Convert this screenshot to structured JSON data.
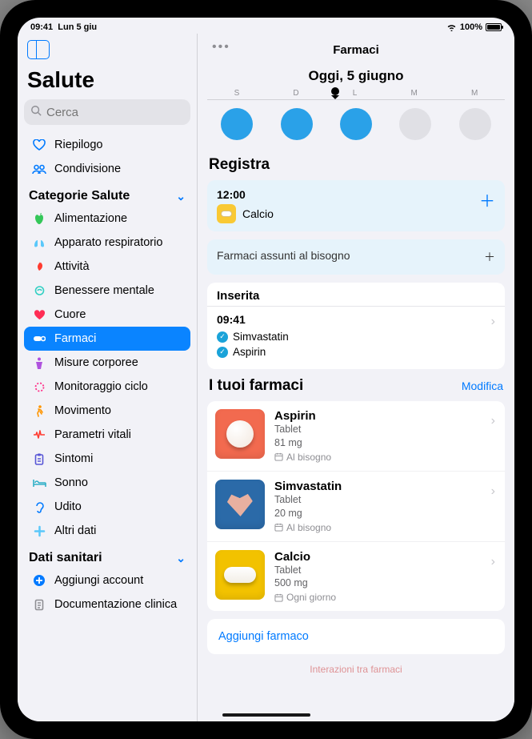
{
  "status": {
    "time": "09:41",
    "date": "Lun 5 giu",
    "battery": "100%"
  },
  "sidebar": {
    "toggle_name": "sidebar-toggle",
    "app_title": "Salute",
    "search_placeholder": "Cerca",
    "top_items": [
      {
        "label": "Riepilogo",
        "icon": "heart-outline",
        "color": "#007aff"
      },
      {
        "label": "Condivisione",
        "icon": "people",
        "color": "#007aff"
      }
    ],
    "categories_title": "Categorie Salute",
    "categories": [
      {
        "label": "Alimentazione",
        "icon": "apple",
        "color": "#34c759"
      },
      {
        "label": "Apparato respiratorio",
        "icon": "lungs",
        "color": "#5ac8fa"
      },
      {
        "label": "Attività",
        "icon": "flame",
        "color": "#ff3b30"
      },
      {
        "label": "Benessere mentale",
        "icon": "mind",
        "color": "#32d0c3"
      },
      {
        "label": "Cuore",
        "icon": "heart",
        "color": "#ff2d55"
      },
      {
        "label": "Farmaci",
        "icon": "pills",
        "color": "#5ac8fa",
        "active": true
      },
      {
        "label": "Misure corporee",
        "icon": "body",
        "color": "#af52de"
      },
      {
        "label": "Monitoraggio ciclo",
        "icon": "cycle",
        "color": "#ff2d87"
      },
      {
        "label": "Movimento",
        "icon": "walk",
        "color": "#ff9500"
      },
      {
        "label": "Parametri vitali",
        "icon": "vitals",
        "color": "#ff3b30"
      },
      {
        "label": "Sintomi",
        "icon": "clipboard",
        "color": "#5856d6"
      },
      {
        "label": "Sonno",
        "icon": "bed",
        "color": "#30b0c7"
      },
      {
        "label": "Udito",
        "icon": "ear",
        "color": "#007aff"
      },
      {
        "label": "Altri dati",
        "icon": "plus",
        "color": "#5ac8fa"
      }
    ],
    "records_title": "Dati sanitari",
    "records": [
      {
        "label": "Aggiungi account",
        "icon": "add-account",
        "color": "#007aff"
      },
      {
        "label": "Documentazione clinica",
        "icon": "doc",
        "color": "#8e8e93"
      }
    ]
  },
  "main": {
    "title": "Farmaci",
    "today": "Oggi, 5 giugno",
    "week_labels": [
      "S",
      "D",
      "L",
      "M",
      "M"
    ],
    "week_states": [
      "filled",
      "filled",
      "filled",
      "empty",
      "empty"
    ],
    "register": {
      "title": "Registra",
      "schedule_time": "12:00",
      "schedule_med": "Calcio",
      "as_needed": "Farmaci assunti al bisogno"
    },
    "logged": {
      "header": "Inserita",
      "time": "09:41",
      "items": [
        "Simvastatin",
        "Aspirin"
      ]
    },
    "your_meds": {
      "title": "I tuoi farmaci",
      "edit": "Modifica",
      "list": [
        {
          "name": "Aspirin",
          "form": "Tablet",
          "dose": "81 mg",
          "sched": "Al bisogno",
          "bg": "#f26a4f",
          "shape": "round"
        },
        {
          "name": "Simvastatin",
          "form": "Tablet",
          "dose": "20 mg",
          "sched": "Al bisogno",
          "bg": "#2b6aa8",
          "shape": "heart"
        },
        {
          "name": "Calcio",
          "form": "Tablet",
          "dose": "500 mg",
          "sched": "Ogni giorno",
          "bg": "#f2c200",
          "shape": "capsule"
        }
      ],
      "add": "Aggiungi farmaco",
      "cutoff": "Interazioni tra farmaci"
    }
  }
}
